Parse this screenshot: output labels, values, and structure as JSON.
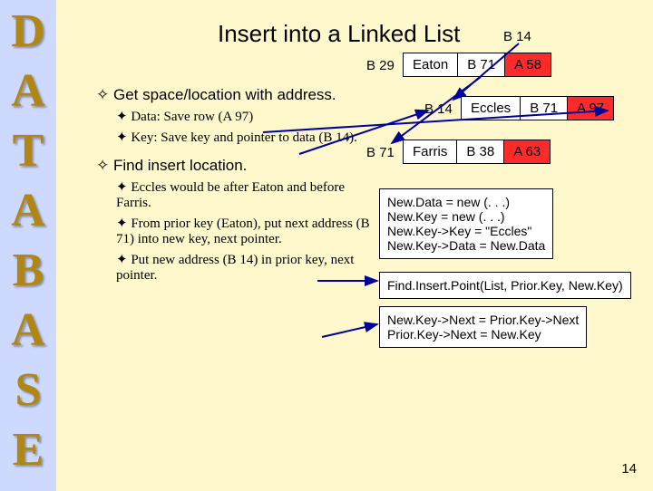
{
  "sidebar_letters": [
    "D",
    "A",
    "T",
    "A",
    "B",
    "A",
    "S",
    "E"
  ],
  "title": "Insert into a Linked List",
  "outline": {
    "p1": "Get space/location with address.",
    "p1a": "Data:  Save row (A 97)",
    "p1b": "Key:  Save key and pointer to data (B 14).",
    "p2": "Find insert location.",
    "p2a": "Eccles would be after Eaton and before Farris.",
    "p2b": "From prior key (Eaton), put next address (B 71) into new key, next pointer.",
    "p2c": "Put new address (B 14) in prior key, next pointer."
  },
  "new_addr_label": "B 14",
  "nodes": {
    "eaton": {
      "addr": "B 29",
      "name": "Eaton",
      "next": "B 71",
      "data": "A 58"
    },
    "eccles": {
      "addr": "B 14",
      "name": "Eccles",
      "next": "B 71",
      "data": "A 97"
    },
    "farris": {
      "addr": "B 71",
      "name": "Farris",
      "next": "B 38",
      "data": "A 63"
    }
  },
  "code": {
    "box1": "New.Data = new (. . .)\nNew.Key = new (. . .)\nNew.Key->Key = \"Eccles\"\nNew.Key->Data = New.Data",
    "box2": "Find.Insert.Point(List, Prior.Key, New.Key)",
    "box3": "New.Key->Next = Prior.Key->Next\nPrior.Key->Next = New.Key"
  },
  "pagenum": "14"
}
